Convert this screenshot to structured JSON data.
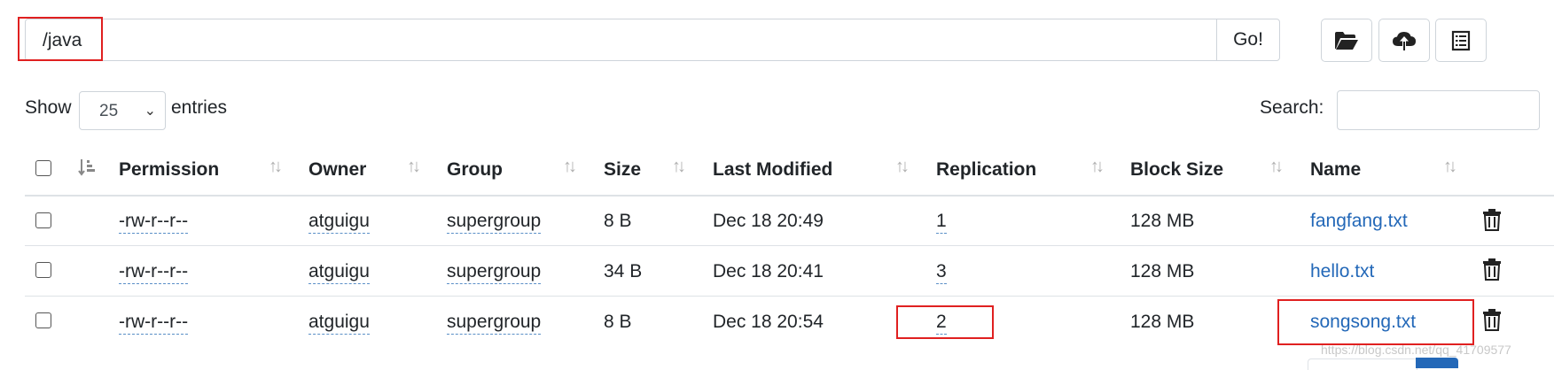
{
  "path_bar": {
    "value": "/java",
    "go_label": "Go!"
  },
  "toolbar": {
    "icons": [
      "folder-open-icon",
      "cloud-upload-icon",
      "list-icon"
    ]
  },
  "table_controls": {
    "show_label": "Show",
    "entries_value": "25",
    "entries_label": "entries",
    "search_label": "Search:",
    "search_value": ""
  },
  "table": {
    "columns": [
      "Permission",
      "Owner",
      "Group",
      "Size",
      "Last Modified",
      "Replication",
      "Block Size",
      "Name"
    ],
    "rows": [
      {
        "permission": "-rw-r--r--",
        "owner": "atguigu",
        "group": "supergroup",
        "size": "8 B",
        "modified": "Dec 18 20:49",
        "replication": "1",
        "block_size": "128 MB",
        "name": "fangfang.txt"
      },
      {
        "permission": "-rw-r--r--",
        "owner": "atguigu",
        "group": "supergroup",
        "size": "34 B",
        "modified": "Dec 18 20:41",
        "replication": "3",
        "block_size": "128 MB",
        "name": "hello.txt"
      },
      {
        "permission": "-rw-r--r--",
        "owner": "atguigu",
        "group": "supergroup",
        "size": "8 B",
        "modified": "Dec 18 20:54",
        "replication": "2",
        "block_size": "128 MB",
        "name": "songsong.txt"
      }
    ]
  },
  "watermark": "https://blog.csdn.net/qq_41709577",
  "colors": {
    "link": "#2368b8",
    "highlight": "#e02020",
    "border": "#ced4da",
    "pagination_active": "#2368b8"
  }
}
